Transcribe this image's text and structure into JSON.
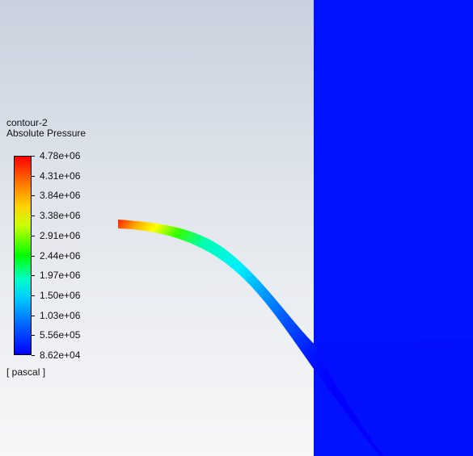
{
  "legend": {
    "contour_name": "contour-2",
    "variable": "Absolute Pressure",
    "units": "[ pascal ]",
    "ticks": [
      "4.78e+06",
      "4.31e+06",
      "3.84e+06",
      "3.38e+06",
      "2.91e+06",
      "2.44e+06",
      "1.97e+06",
      "1.50e+06",
      "1.03e+06",
      "5.56e+05",
      "8.62e+04"
    ],
    "colormap": [
      "#ff0000",
      "#ff6a00",
      "#ffd200",
      "#c8ff00",
      "#00ff00",
      "#00ffc8",
      "#00c8ff",
      "#0064ff",
      "#0000ff"
    ]
  },
  "viewport": {
    "background_top": "#c9d1de",
    "background_bottom": "#f7f7f8",
    "domain_color": "#0012ff"
  }
}
